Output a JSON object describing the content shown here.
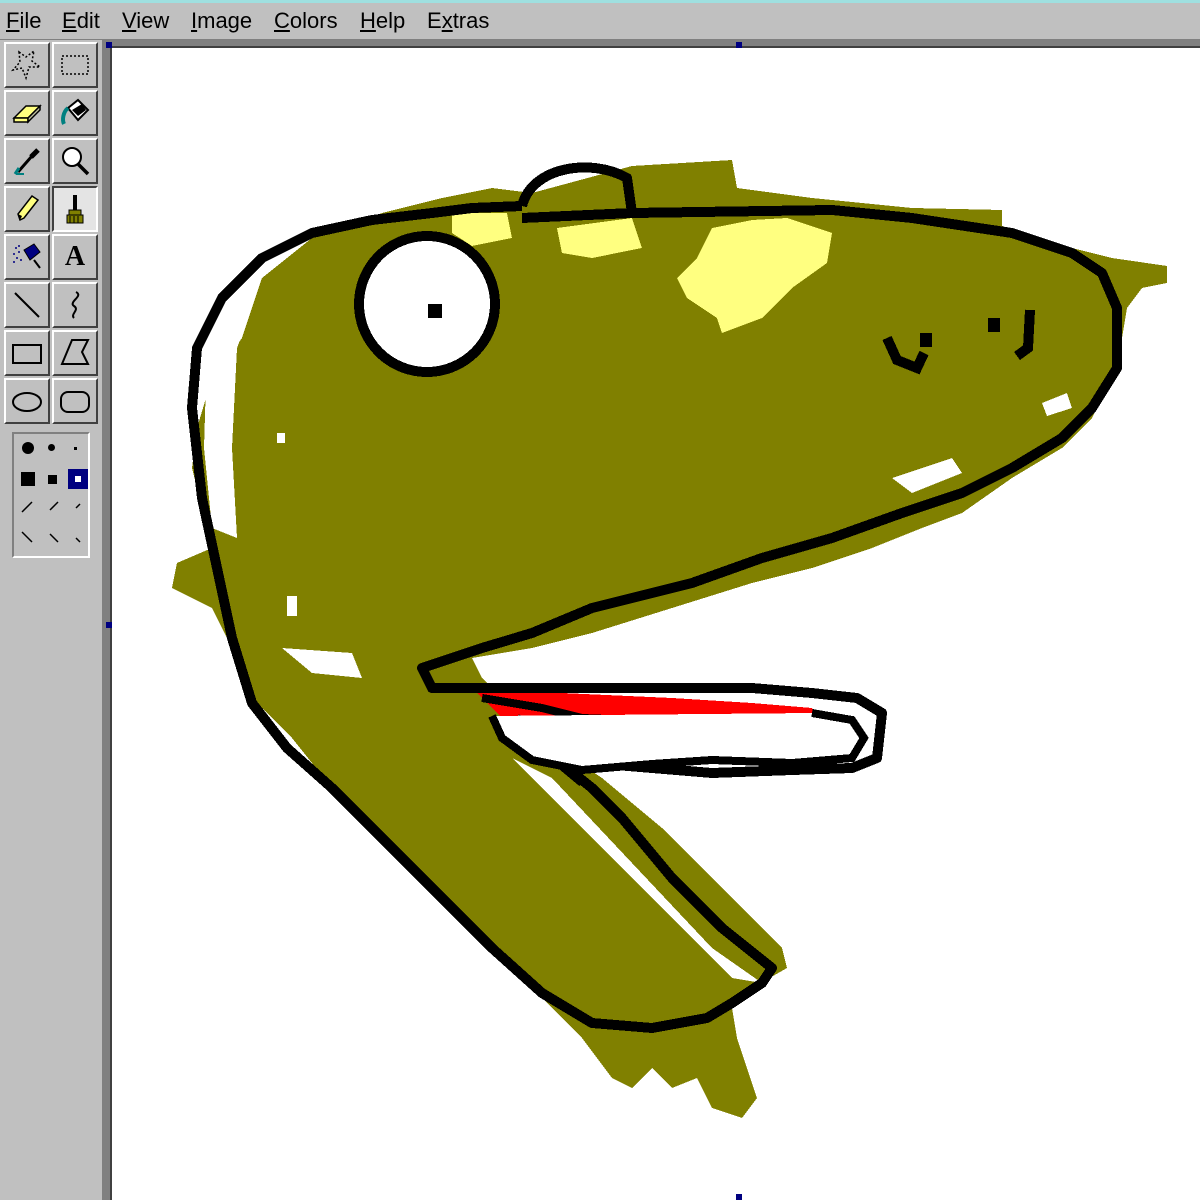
{
  "menubar": {
    "items": [
      {
        "id": "file",
        "mnemonic": "F",
        "rest": "ile"
      },
      {
        "id": "edit",
        "mnemonic": "E",
        "rest": "dit"
      },
      {
        "id": "view",
        "mnemonic": "V",
        "rest": "iew"
      },
      {
        "id": "image",
        "mnemonic": "I",
        "rest": "mage"
      },
      {
        "id": "colors",
        "mnemonic": "C",
        "rest": "olors"
      },
      {
        "id": "help",
        "mnemonic": "H",
        "rest": "elp"
      },
      {
        "id": "extras",
        "pre": "E",
        "mnemonic": "x",
        "rest": "tras"
      }
    ]
  },
  "toolbox": {
    "tools": [
      {
        "name": "free-form-select",
        "icon": "free-select-icon",
        "selected": false
      },
      {
        "name": "select",
        "icon": "rect-select-icon",
        "selected": false
      },
      {
        "name": "eraser",
        "icon": "eraser-icon",
        "selected": false
      },
      {
        "name": "fill-with-color",
        "icon": "paint-bucket-icon",
        "selected": false
      },
      {
        "name": "pick-color",
        "icon": "eyedropper-icon",
        "selected": false
      },
      {
        "name": "magnifier",
        "icon": "magnifier-icon",
        "selected": false
      },
      {
        "name": "pencil",
        "icon": "pencil-icon",
        "selected": false
      },
      {
        "name": "brush",
        "icon": "brush-icon",
        "selected": true
      },
      {
        "name": "airbrush",
        "icon": "airbrush-icon",
        "selected": false
      },
      {
        "name": "text",
        "icon": "text-icon",
        "selected": false
      },
      {
        "name": "line",
        "icon": "line-icon",
        "selected": false
      },
      {
        "name": "curve",
        "icon": "curve-icon",
        "selected": false
      },
      {
        "name": "rectangle",
        "icon": "rectangle-icon",
        "selected": false
      },
      {
        "name": "polygon",
        "icon": "polygon-icon",
        "selected": false
      },
      {
        "name": "ellipse",
        "icon": "ellipse-icon",
        "selected": false
      },
      {
        "name": "rounded-rectangle",
        "icon": "rounded-rect-icon",
        "selected": false
      }
    ],
    "text_tool_glyph": "A",
    "brush_options": {
      "selected_index": 5
    }
  },
  "palette": {
    "olive": "#808000",
    "light_yellow": "#ffff80",
    "red": "#ff0000",
    "black": "#000000",
    "white": "#ffffff",
    "face_gray": "#c0c0c0",
    "selection_navy": "#000080"
  }
}
